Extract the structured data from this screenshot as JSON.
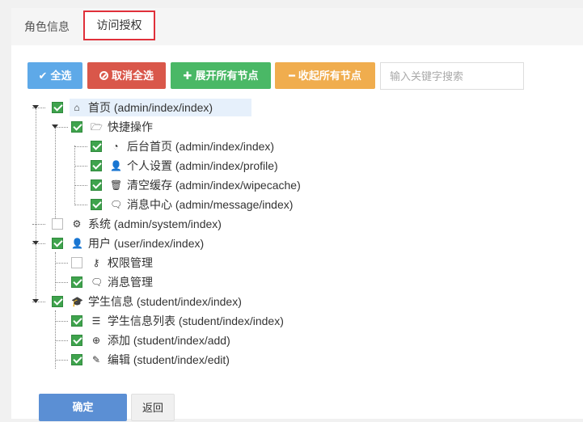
{
  "tabs": {
    "role_info": "角色信息",
    "access_auth": "访问授权"
  },
  "toolbar": {
    "select_all": "全选",
    "deselect_all": "取消全选",
    "expand_all": "展开所有节点",
    "collapse_all": "收起所有节点",
    "search_placeholder": "输入关键字搜索",
    "search_value": ""
  },
  "tree": [
    {
      "label": "首页 (admin/index/index)",
      "icon": "home-icon",
      "checked": true,
      "expanded": true,
      "level": 0,
      "highlight": true
    },
    {
      "label": "快捷操作",
      "icon": "folder-open-icon",
      "checked": true,
      "expanded": true,
      "level": 1
    },
    {
      "label": "后台首页 (admin/index/index)",
      "icon": "dashboard-icon",
      "checked": true,
      "level": 2
    },
    {
      "label": "个人设置 (admin/index/profile)",
      "icon": "user-icon",
      "checked": true,
      "level": 2
    },
    {
      "label": "清空缓存 (admin/index/wipecache)",
      "icon": "trash-icon",
      "checked": true,
      "level": 2
    },
    {
      "label": "消息中心 (admin/message/index)",
      "icon": "comments-icon",
      "checked": true,
      "level": 2
    },
    {
      "label": "系统 (admin/system/index)",
      "icon": "gear-icon",
      "checked": false,
      "level": 0
    },
    {
      "label": "用户 (user/index/index)",
      "icon": "user-icon",
      "checked": true,
      "expanded": true,
      "level": 0
    },
    {
      "label": "权限管理",
      "icon": "key-icon",
      "checked": false,
      "level": 1
    },
    {
      "label": "消息管理",
      "icon": "comments-icon",
      "checked": true,
      "level": 1
    },
    {
      "label": "学生信息 (student/index/index)",
      "icon": "graduation-cap-icon",
      "checked": true,
      "expanded": true,
      "level": 0
    },
    {
      "label": "学生信息列表 (student/index/index)",
      "icon": "list-icon",
      "checked": true,
      "level": 1
    },
    {
      "label": "添加 (student/index/add)",
      "icon": "plus-circle-icon",
      "checked": true,
      "level": 1
    },
    {
      "label": "编辑 (student/index/edit)",
      "icon": "pencil-icon",
      "checked": true,
      "level": 1
    }
  ],
  "footer": {
    "confirm": "确定",
    "back": "返回"
  },
  "colors": {
    "tab_active_border": "#e0303a",
    "btn_select_all": "#5ea9e8",
    "btn_deselect_all": "#d9574a",
    "btn_expand": "#4ab866",
    "btn_collapse": "#f0ad4e",
    "btn_confirm": "#5b8fd4",
    "checkbox_checked": "#3fa34d"
  }
}
